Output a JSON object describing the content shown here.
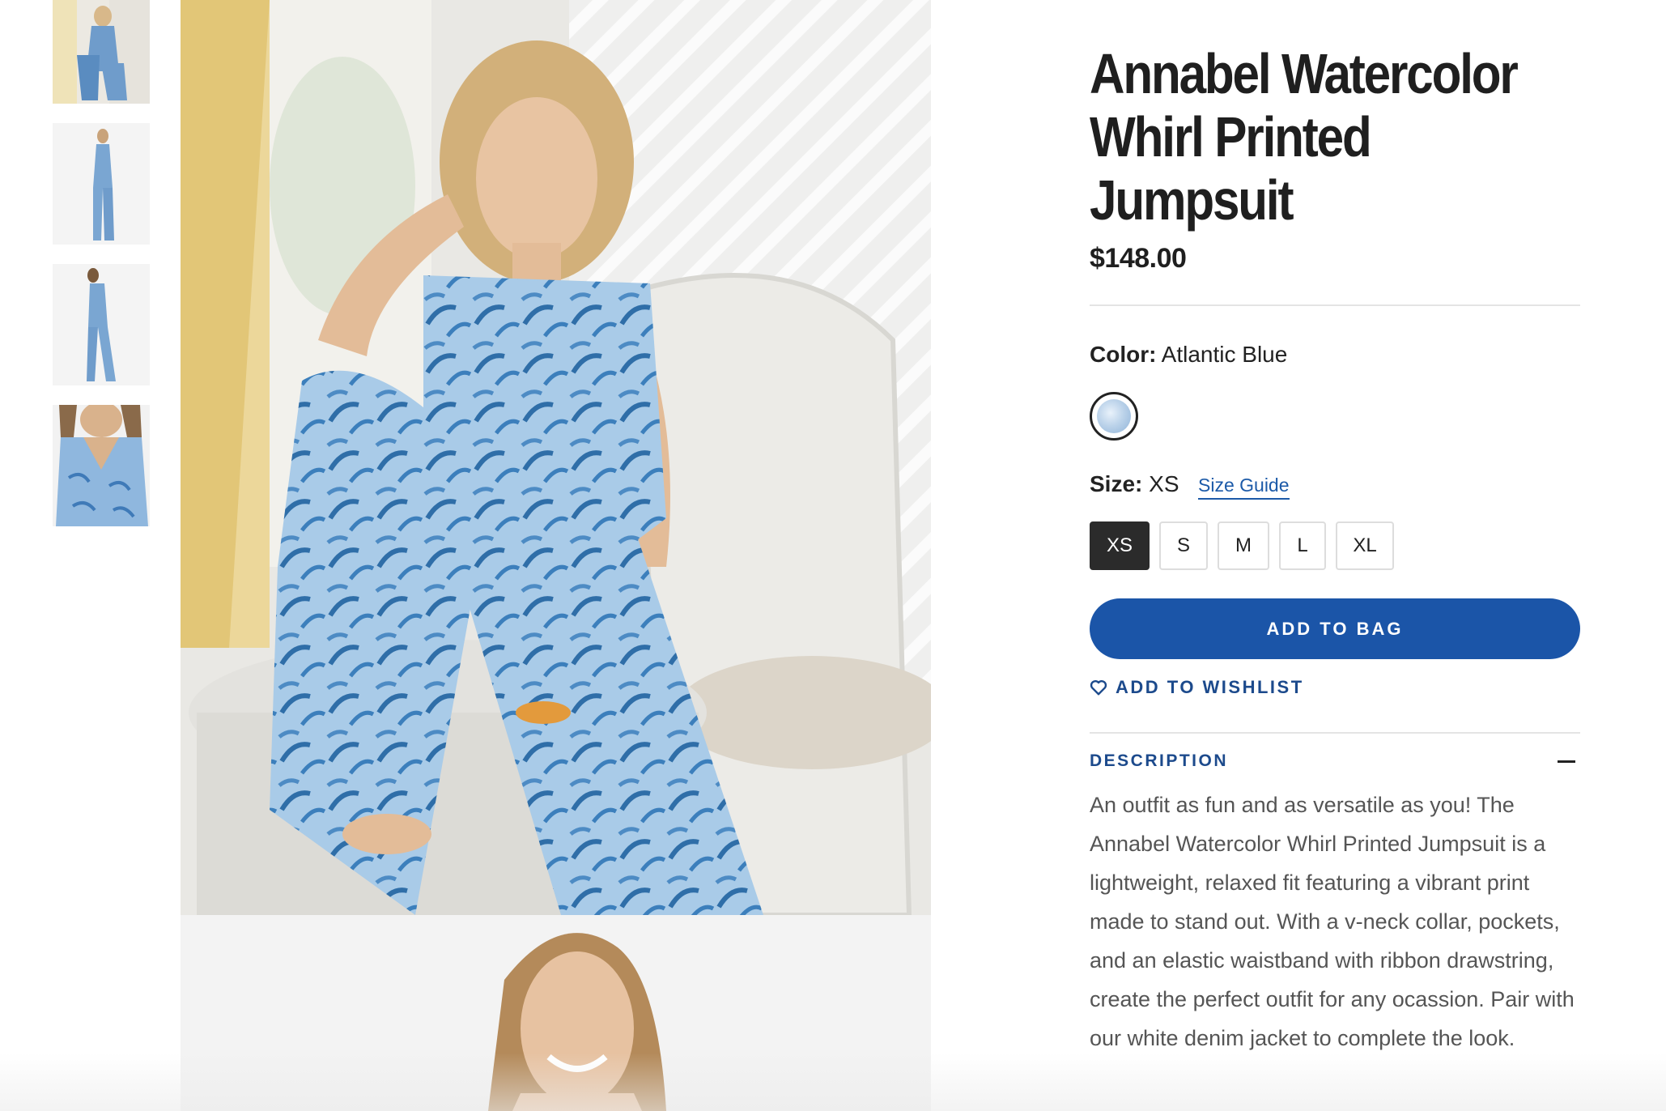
{
  "product": {
    "title": "Annabel Watercolor Whirl Printed Jumpsuit",
    "price": "$148.00"
  },
  "color": {
    "label": "Color:",
    "value": "Atlantic Blue",
    "swatch_color": "#a9c6e4"
  },
  "size": {
    "label": "Size:",
    "value": "XS",
    "guide_label": "Size Guide",
    "options": [
      "XS",
      "S",
      "M",
      "L",
      "XL"
    ],
    "selected": "XS"
  },
  "actions": {
    "add_to_bag": "ADD TO BAG",
    "add_to_wishlist": "ADD TO WISHLIST"
  },
  "description": {
    "heading": "DESCRIPTION",
    "text": "An outfit as fun and as versatile as you! The Annabel Watercolor Whirl Printed Jumpsuit is a lightweight, relaxed fit featuring a vibrant print made to stand out. With a v-neck collar, pockets, and an elastic waistband with ribbon drawstring, create the perfect outfit for any ocassion. Pair with our white denim jacket to complete the look."
  },
  "colors": {
    "accent": "#1b55a8",
    "link": "#1c5aa8",
    "heading_blue": "#1c4a8c",
    "selected_size_bg": "#2b2b2b"
  },
  "icons": {
    "wishlist": "heart-outline-icon",
    "collapse": "minus-icon"
  }
}
